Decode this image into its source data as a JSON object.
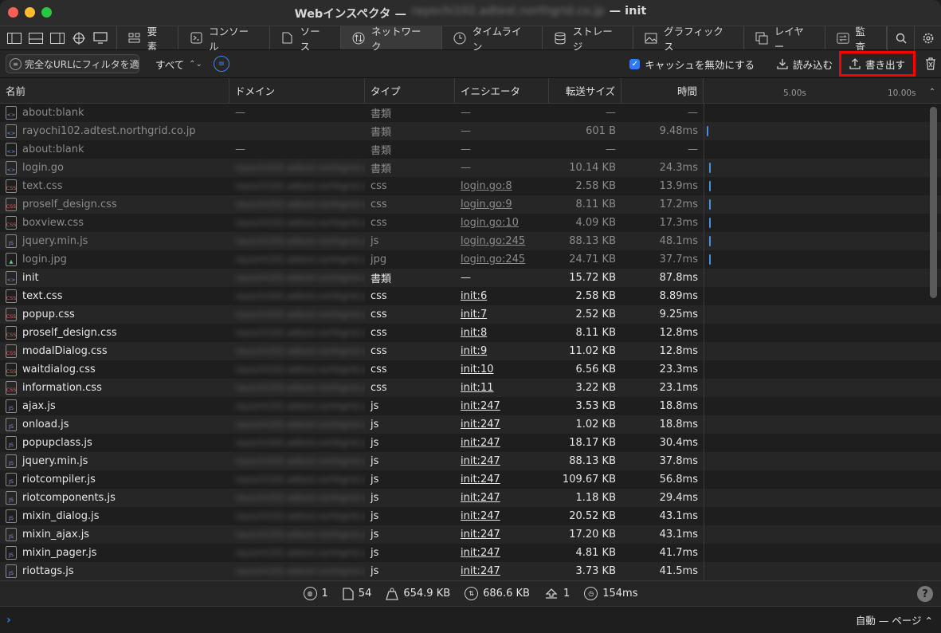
{
  "window": {
    "title_prefix": "Webインスペクタ —",
    "title_host": "rayochi102.adtest.northgrid.co.jp",
    "title_suffix": "— init"
  },
  "tabs": [
    {
      "label": "要素",
      "icon": "elements-icon",
      "active": false
    },
    {
      "label": "コンソール",
      "icon": "console-icon",
      "active": false
    },
    {
      "label": "ソース",
      "icon": "sources-icon",
      "active": false
    },
    {
      "label": "ネットワーク",
      "icon": "network-icon",
      "active": true
    },
    {
      "label": "タイムライン",
      "icon": "timeline-icon",
      "active": false
    },
    {
      "label": "ストレージ",
      "icon": "storage-icon",
      "active": false
    },
    {
      "label": "グラフィックス",
      "icon": "graphics-icon",
      "active": false
    },
    {
      "label": "レイヤー",
      "icon": "layers-icon",
      "active": false
    },
    {
      "label": "監査",
      "icon": "audit-icon",
      "active": false
    }
  ],
  "filterbar": {
    "filter_placeholder": "完全なURLにフィルタを適",
    "type_selected": "すべて",
    "disable_cache_label": "キャッシュを無効にする",
    "disable_cache_checked": true,
    "import_label": "読み込む",
    "export_label": "書き出す"
  },
  "columns": {
    "name": "名前",
    "domain": "ドメイン",
    "type": "タイプ",
    "initiator": "イニシエータ",
    "size": "転送サイズ",
    "time": "時間",
    "tick_1": "5.00s",
    "tick_2": "10.00s"
  },
  "rows": [
    {
      "name": "about:blank",
      "domain": "—",
      "type": "書類",
      "initiator": "—",
      "size": "—",
      "time": "—",
      "icon": "doc",
      "dim": true,
      "wf": null
    },
    {
      "name": "rayochi102.adtest.northgrid.co.jp",
      "domain": "",
      "type": "書類",
      "initiator": "—",
      "size": "601 B",
      "time": "9.48ms",
      "icon": "doc",
      "dim": true,
      "wf": 0.012
    },
    {
      "name": "about:blank",
      "domain": "—",
      "type": "書類",
      "initiator": "—",
      "size": "—",
      "time": "—",
      "icon": "doc",
      "dim": true,
      "wf": null
    },
    {
      "name": "login.go",
      "domain": "rayochi102.adtest.northgrid.co.jp",
      "type": "書類",
      "initiator": "—",
      "size": "10.14 KB",
      "time": "24.3ms",
      "icon": "doc",
      "dim": true,
      "wf": 0.02
    },
    {
      "name": "text.css",
      "domain": "rayochi102.adtest.northgrid.co.jp",
      "type": "css",
      "initiator": "login.go:8",
      "size": "2.58 KB",
      "time": "13.9ms",
      "icon": "css",
      "dim": true,
      "wf": 0.022
    },
    {
      "name": "proself_design.css",
      "domain": "rayochi102.adtest.northgrid.co.jp",
      "type": "css",
      "initiator": "login.go:9",
      "size": "8.11 KB",
      "time": "17.2ms",
      "icon": "css",
      "dim": true,
      "wf": 0.022
    },
    {
      "name": "boxview.css",
      "domain": "rayochi102.adtest.northgrid.co.jp",
      "type": "css",
      "initiator": "login.go:10",
      "size": "4.09 KB",
      "time": "17.3ms",
      "icon": "css",
      "dim": true,
      "wf": 0.022
    },
    {
      "name": "jquery.min.js",
      "domain": "rayochi102.adtest.northgrid.co.jp",
      "type": "js",
      "initiator": "login.go:245",
      "size": "88.13 KB",
      "time": "48.1ms",
      "icon": "js",
      "dim": true,
      "wf": 0.022
    },
    {
      "name": "login.jpg",
      "domain": "rayochi102.adtest.northgrid.co.jp",
      "type": "jpg",
      "initiator": "login.go:245",
      "size": "24.71 KB",
      "time": "37.7ms",
      "icon": "img",
      "dim": true,
      "wf": 0.022
    },
    {
      "name": "init",
      "domain": "rayochi102.adtest.northgrid.co.jp",
      "type": "書類",
      "initiator": "—",
      "size": "15.72 KB",
      "time": "87.8ms",
      "icon": "doc",
      "dim": false,
      "wf": null
    },
    {
      "name": "text.css",
      "domain": "rayochi102.adtest.northgrid.co.jp",
      "type": "css",
      "initiator": "init:6",
      "size": "2.58 KB",
      "time": "8.89ms",
      "icon": "css",
      "dim": false,
      "wf": null
    },
    {
      "name": "popup.css",
      "domain": "rayochi102.adtest.northgrid.co.jp",
      "type": "css",
      "initiator": "init:7",
      "size": "2.52 KB",
      "time": "9.25ms",
      "icon": "css",
      "dim": false,
      "wf": null
    },
    {
      "name": "proself_design.css",
      "domain": "rayochi102.adtest.northgrid.co.jp",
      "type": "css",
      "initiator": "init:8",
      "size": "8.11 KB",
      "time": "12.8ms",
      "icon": "css",
      "dim": false,
      "wf": null
    },
    {
      "name": "modalDialog.css",
      "domain": "rayochi102.adtest.northgrid.co.jp",
      "type": "css",
      "initiator": "init:9",
      "size": "11.02 KB",
      "time": "12.8ms",
      "icon": "css",
      "dim": false,
      "wf": null
    },
    {
      "name": "waitdialog.css",
      "domain": "rayochi102.adtest.northgrid.co.jp",
      "type": "css",
      "initiator": "init:10",
      "size": "6.56 KB",
      "time": "23.3ms",
      "icon": "css",
      "dim": false,
      "wf": null
    },
    {
      "name": "information.css",
      "domain": "rayochi102.adtest.northgrid.co.jp",
      "type": "css",
      "initiator": "init:11",
      "size": "3.22 KB",
      "time": "23.1ms",
      "icon": "css",
      "dim": false,
      "wf": null
    },
    {
      "name": "ajax.js",
      "domain": "rayochi102.adtest.northgrid.co.jp",
      "type": "js",
      "initiator": "init:247",
      "size": "3.53 KB",
      "time": "18.8ms",
      "icon": "js",
      "dim": false,
      "wf": null
    },
    {
      "name": "onload.js",
      "domain": "rayochi102.adtest.northgrid.co.jp",
      "type": "js",
      "initiator": "init:247",
      "size": "1.02 KB",
      "time": "18.8ms",
      "icon": "js",
      "dim": false,
      "wf": null
    },
    {
      "name": "popupclass.js",
      "domain": "rayochi102.adtest.northgrid.co.jp",
      "type": "js",
      "initiator": "init:247",
      "size": "18.17 KB",
      "time": "30.4ms",
      "icon": "js",
      "dim": false,
      "wf": null
    },
    {
      "name": "jquery.min.js",
      "domain": "rayochi102.adtest.northgrid.co.jp",
      "type": "js",
      "initiator": "init:247",
      "size": "88.13 KB",
      "time": "37.8ms",
      "icon": "js",
      "dim": false,
      "wf": null
    },
    {
      "name": "riotcompiler.js",
      "domain": "rayochi102.adtest.northgrid.co.jp",
      "type": "js",
      "initiator": "init:247",
      "size": "109.67 KB",
      "time": "56.8ms",
      "icon": "js",
      "dim": false,
      "wf": null
    },
    {
      "name": "riotcomponents.js",
      "domain": "rayochi102.adtest.northgrid.co.jp",
      "type": "js",
      "initiator": "init:247",
      "size": "1.18 KB",
      "time": "29.4ms",
      "icon": "js",
      "dim": false,
      "wf": null
    },
    {
      "name": "mixin_dialog.js",
      "domain": "rayochi102.adtest.northgrid.co.jp",
      "type": "js",
      "initiator": "init:247",
      "size": "20.52 KB",
      "time": "43.1ms",
      "icon": "js",
      "dim": false,
      "wf": null
    },
    {
      "name": "mixin_ajax.js",
      "domain": "rayochi102.adtest.northgrid.co.jp",
      "type": "js",
      "initiator": "init:247",
      "size": "17.20 KB",
      "time": "43.1ms",
      "icon": "js",
      "dim": false,
      "wf": null
    },
    {
      "name": "mixin_pager.js",
      "domain": "rayochi102.adtest.northgrid.co.jp",
      "type": "js",
      "initiator": "init:247",
      "size": "4.81 KB",
      "time": "41.7ms",
      "icon": "js",
      "dim": false,
      "wf": null
    },
    {
      "name": "riottags.js",
      "domain": "rayochi102.adtest.northgrid.co.jp",
      "type": "js",
      "initiator": "init:247",
      "size": "3.73 KB",
      "time": "41.5ms",
      "icon": "js",
      "dim": false,
      "wf": null
    }
  ],
  "status": {
    "domains": "1",
    "resources": "54",
    "size": "654.9 KB",
    "transferred": "686.6 KB",
    "redirects": "1",
    "time": "154ms",
    "help": "?"
  },
  "console": {
    "prompt": "›",
    "context": "自動 — ページ ⌃"
  }
}
